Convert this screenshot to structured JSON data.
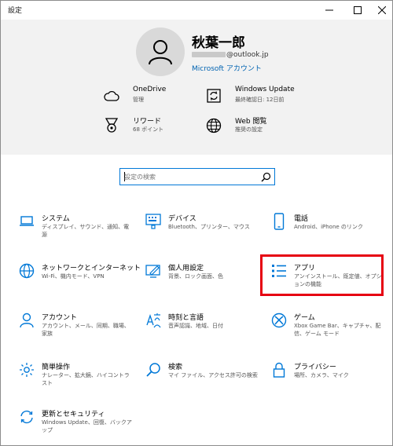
{
  "window": {
    "title": "設定"
  },
  "user": {
    "name": "秋葉一郎",
    "email_suffix": "@outlook.jp",
    "account_link": "Microsoft アカウント"
  },
  "header_items": [
    {
      "label": "OneDrive",
      "sub": "管理",
      "icon": "cloud-icon"
    },
    {
      "label": "Windows Update",
      "sub": "最終確認日: 12日前",
      "icon": "update-icon"
    },
    {
      "label": "リワード",
      "sub": "68 ポイント",
      "icon": "medal-icon"
    },
    {
      "label": "Web 閲覧",
      "sub": "推奨の設定",
      "icon": "globe-icon"
    }
  ],
  "search": {
    "placeholder": "設定の検索"
  },
  "tiles": [
    {
      "label": "システム",
      "desc": "ディスプレイ、サウンド、通知、電源",
      "icon": "laptop-icon"
    },
    {
      "label": "デバイス",
      "desc": "Bluetooth、プリンター、マウス",
      "icon": "keyboard-icon"
    },
    {
      "label": "電話",
      "desc": "Android、iPhone のリンク",
      "icon": "phone-icon"
    },
    {
      "label": "ネットワークとインターネット",
      "desc": "Wi-Fi、機内モード、VPN",
      "icon": "globe-icon"
    },
    {
      "label": "個人用設定",
      "desc": "背景、ロック画面、色",
      "icon": "personalize-icon"
    },
    {
      "label": "アプリ",
      "desc": "アンインストール、既定値、オプションの機能",
      "icon": "apps-list-icon"
    },
    {
      "label": "アカウント",
      "desc": "アカウント、メール、同期、職場、家族",
      "icon": "person-icon"
    },
    {
      "label": "時刻と言語",
      "desc": "音声認識、地域、日付",
      "icon": "time-language-icon"
    },
    {
      "label": "ゲーム",
      "desc": "Xbox Game Bar、キャプチャ、配信、ゲーム モード",
      "icon": "xbox-icon"
    },
    {
      "label": "簡単操作",
      "desc": "ナレーター、拡大鏡、ハイコントラスト",
      "icon": "ease-of-access-icon"
    },
    {
      "label": "検索",
      "desc": "マイ ファイル、アクセス許可の検索",
      "icon": "search-icon"
    },
    {
      "label": "プライバシー",
      "desc": "場所、カメラ、マイク",
      "icon": "lock-icon"
    },
    {
      "label": "更新とセキュリティ",
      "desc": "Windows Update、回復、バックアップ",
      "icon": "sync-icon"
    }
  ],
  "colors": {
    "accent": "#0078d7",
    "highlight": "#e60012",
    "header_bg": "#f2f2f2"
  }
}
